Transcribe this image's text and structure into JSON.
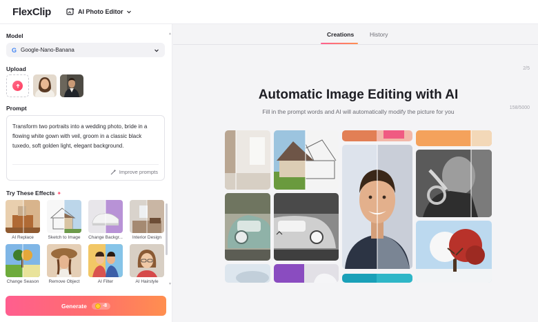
{
  "header": {
    "logo_text": "FlexClip",
    "editor_label": "AI Photo Editor"
  },
  "left_panel": {
    "model_label": "Model",
    "model_value": "Google-Nano-Banana",
    "upload_label": "Upload",
    "upload_count": "2/5",
    "prompt_label": "Prompt",
    "prompt_count": "158/5000",
    "prompt_text": "Transform two portraits into a wedding photo, bride in a flowing white gown with veil, groom in a classic black tuxedo, soft golden light, elegant background.",
    "improve_label": "Improve prompts",
    "effects_title": "Try These Effects",
    "effects": [
      {
        "label": "AI Replace"
      },
      {
        "label": "Sketch to Image"
      },
      {
        "label": "Change Backgr..."
      },
      {
        "label": "Interior Design"
      },
      {
        "label": "Change Season"
      },
      {
        "label": "Remove Object"
      },
      {
        "label": "AI Filter"
      },
      {
        "label": "AI Hairstyle"
      }
    ],
    "generate_label": "Generate",
    "generate_cost": "-8"
  },
  "main": {
    "tabs": [
      {
        "label": "Creations",
        "active": true
      },
      {
        "label": "History",
        "active": false
      }
    ],
    "title": "Automatic Image Editing with AI",
    "subtitle": "Fill in the prompt words and AI will automatically modify the picture for you"
  },
  "colors": {
    "accent_start": "#ff5e8f",
    "accent_end": "#ff8f4f"
  }
}
